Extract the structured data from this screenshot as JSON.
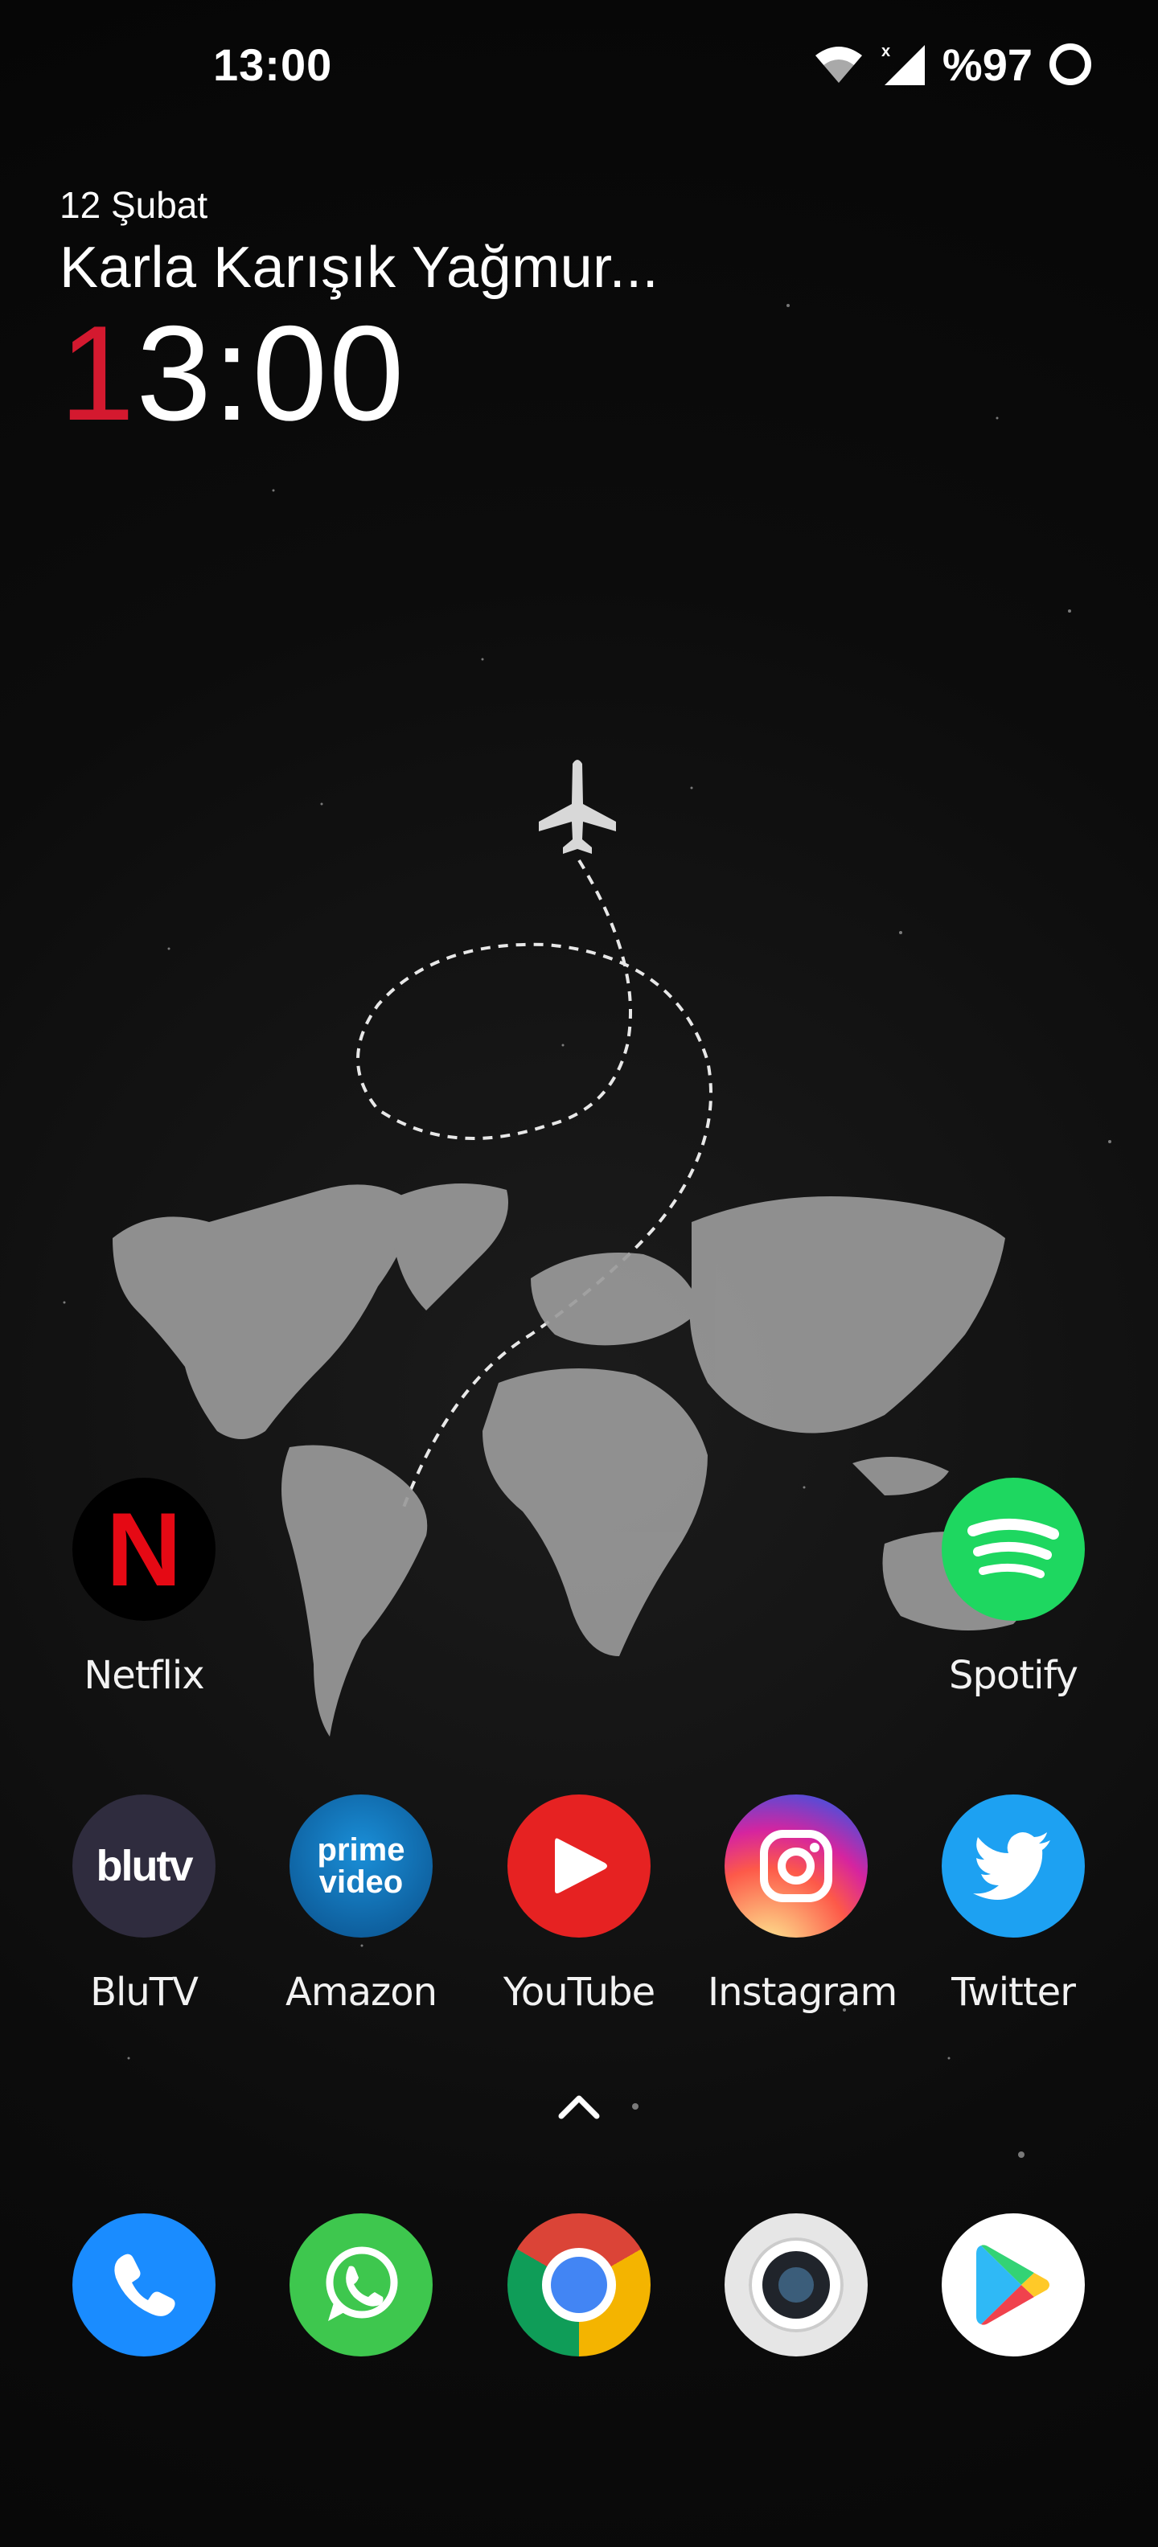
{
  "status_bar": {
    "time": "13:00",
    "battery": "%97",
    "icons": [
      "wifi-icon",
      "signal-no-data-icon",
      "battery-ring-icon"
    ]
  },
  "widget": {
    "date": "12 Şubat",
    "weather": "Karla Karışık Yağmur...",
    "clock_first_digit": "1",
    "clock_rest": "3:00"
  },
  "apps_row1": [
    {
      "name": "Netflix",
      "icon": "netflix-icon"
    },
    {
      "name": "Spotify",
      "icon": "spotify-icon"
    }
  ],
  "apps_row2": [
    {
      "name": "BluTV",
      "icon": "blutv-icon"
    },
    {
      "name": "Amazon",
      "icon": "prime-video-icon"
    },
    {
      "name": "YouTube",
      "icon": "youtube-icon"
    },
    {
      "name": "Instagram",
      "icon": "instagram-icon"
    },
    {
      "name": "Twitter",
      "icon": "twitter-icon"
    }
  ],
  "icon_texts": {
    "blutv": "blutv",
    "prime": "prime",
    "video": "video",
    "netflix": "N"
  },
  "dock": [
    {
      "icon": "phone-icon"
    },
    {
      "icon": "whatsapp-icon"
    },
    {
      "icon": "chrome-icon"
    },
    {
      "icon": "camera-icon"
    },
    {
      "icon": "play-store-icon"
    }
  ],
  "colors": {
    "accent_red": "#d4192f",
    "netflix_red": "#e50914",
    "spotify_green": "#1ed760",
    "youtube_red": "#e62222",
    "twitter_blue": "#1da1f2",
    "phone_blue": "#1a8cff",
    "whatsapp_green": "#3ec74e"
  }
}
